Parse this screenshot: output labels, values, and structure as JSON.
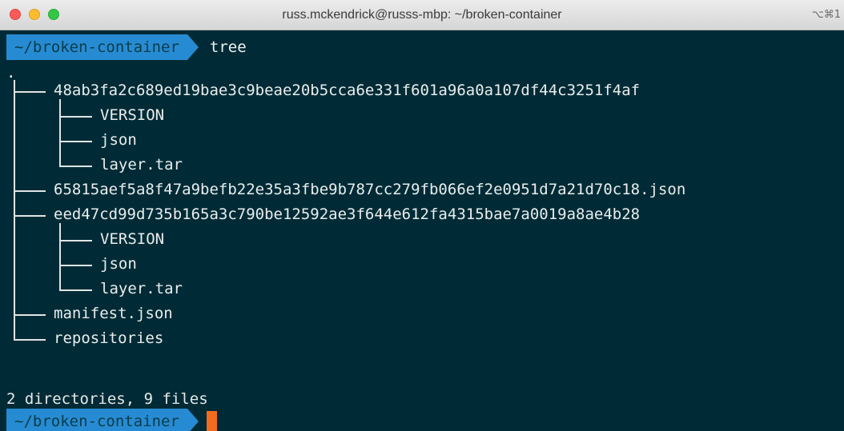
{
  "window": {
    "title": "russ.mckendrick@russs-mbp: ~/broken-container",
    "shortcut": "⌥⌘1"
  },
  "prompt": {
    "path": "~/broken-container",
    "command": "tree"
  },
  "output": {
    "root": ".",
    "entries": [
      {
        "name": "48ab3fa2c689ed19bae3c9beae20b5cca6e331f601a96a0a107df44c3251f4af",
        "level": 1,
        "children": [
          "VERSION",
          "json",
          "layer.tar"
        ]
      },
      {
        "name": "65815aef5a8f47a9befb22e35a3fbe9b787cc279fb066ef2e0951d7a21d70c18.json",
        "level": 1,
        "children": []
      },
      {
        "name": "eed47cd99d735b165a3c790be12592ae3f644e612fa4315bae7a0019a8ae4b28",
        "level": 1,
        "children": [
          "VERSION",
          "json",
          "layer.tar"
        ]
      },
      {
        "name": "manifest.json",
        "level": 1,
        "children": []
      },
      {
        "name": "repositories",
        "level": 1,
        "children": []
      }
    ],
    "summary": "2 directories, 9 files"
  },
  "colors": {
    "background": "#002b36",
    "prompt_segment": "#268bd2",
    "cursor": "#f26b1d",
    "text": "#e9eded"
  }
}
